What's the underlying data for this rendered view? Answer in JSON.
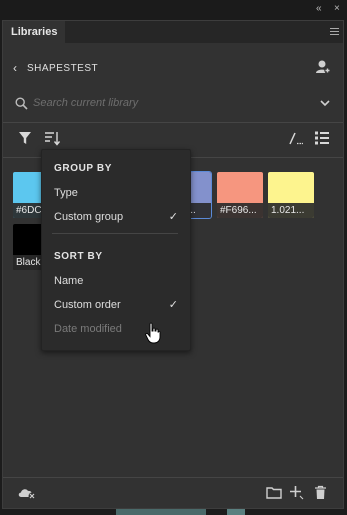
{
  "panel": {
    "title": "Libraries"
  },
  "library": {
    "name": "SHAPESTEST"
  },
  "search": {
    "placeholder": "Search current library"
  },
  "swatches": [
    {
      "label": "#6DC",
      "color": "#5cc7ef"
    },
    {
      "label": "...93...",
      "color": "#8391cc"
    },
    {
      "label": "#F696...",
      "color": "#f6967f"
    },
    {
      "label": "1.021...",
      "color": "#fdf48e"
    },
    {
      "label": "Black",
      "color": "#000000"
    }
  ],
  "menu": {
    "group_by": {
      "heading": "GROUP BY",
      "items": [
        {
          "label": "Type",
          "checked": false
        },
        {
          "label": "Custom group",
          "checked": true
        }
      ]
    },
    "sort_by": {
      "heading": "SORT BY",
      "items": [
        {
          "label": "Name",
          "checked": false
        },
        {
          "label": "Custom order",
          "checked": true
        },
        {
          "label": "Date modified",
          "checked": false,
          "disabled": true
        }
      ]
    },
    "check_glyph": "✓"
  },
  "window": {
    "collapse_glyph": "«",
    "close_glyph": "×"
  }
}
